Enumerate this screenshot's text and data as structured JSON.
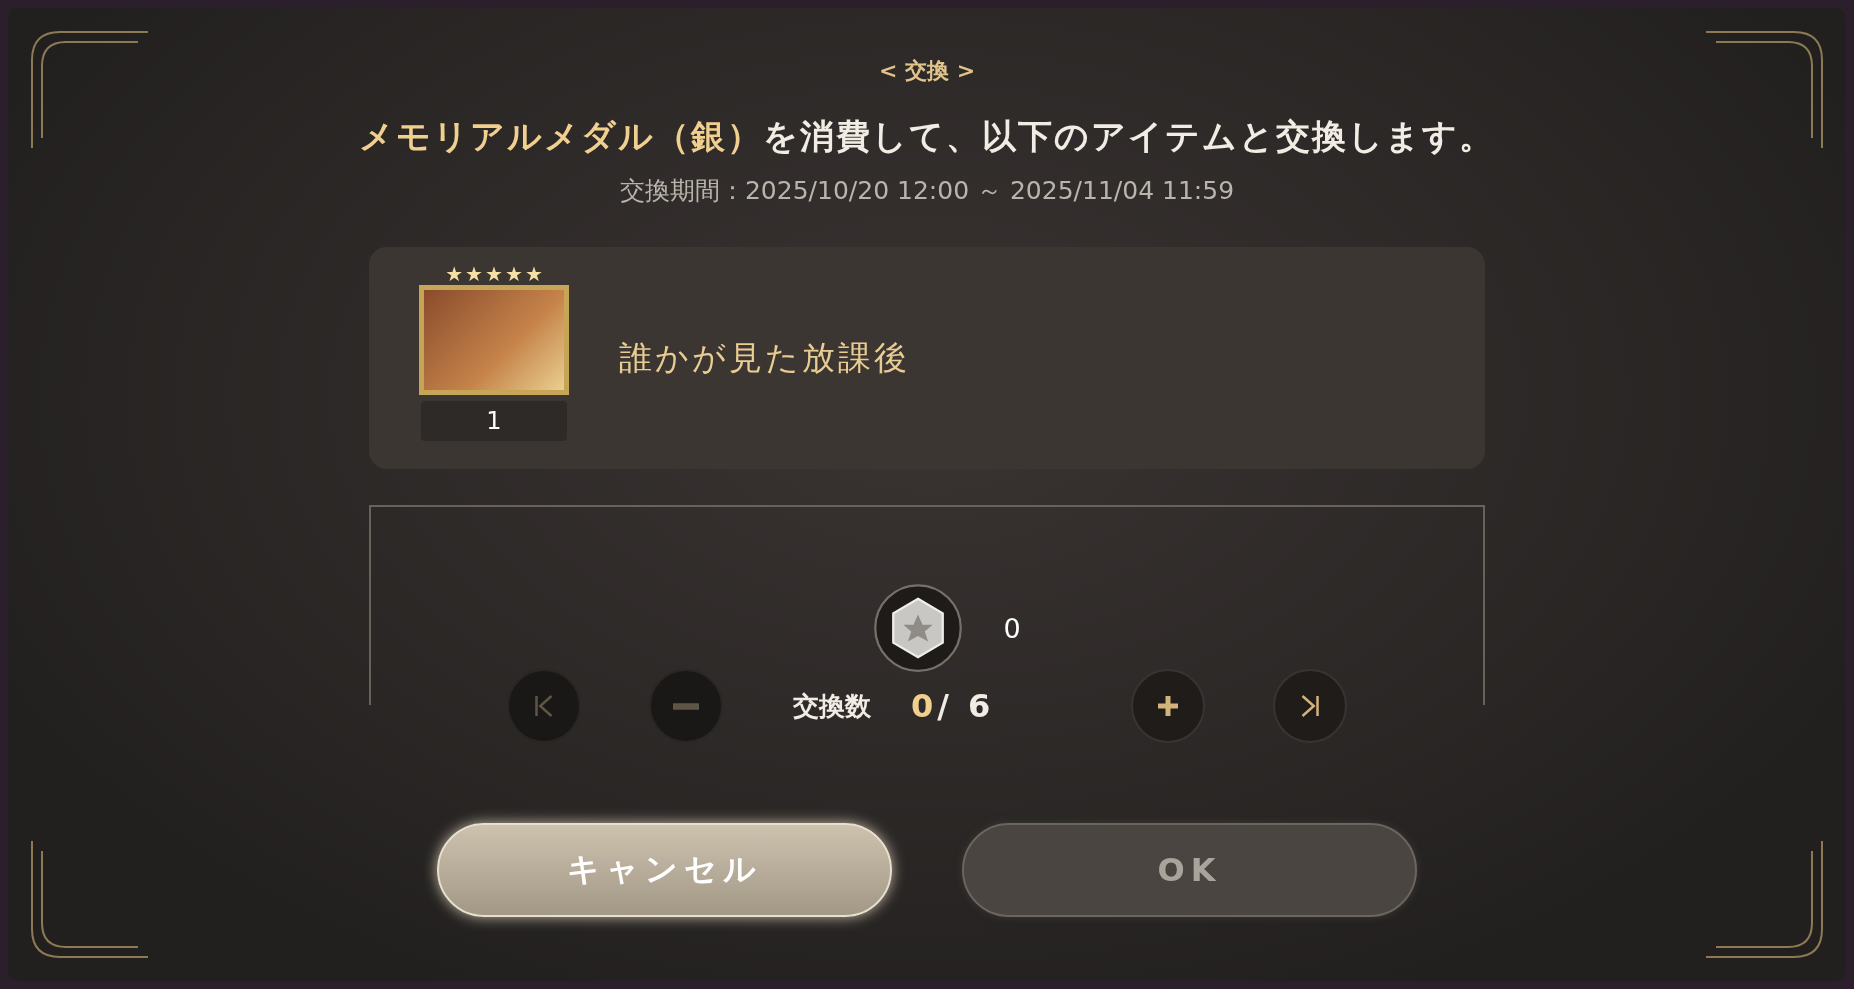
{
  "dialog": {
    "title": "< 交換 >",
    "message": {
      "highlight": "メモリアルメダル（銀）",
      "text": "を消費して、以下のアイテムと交換します。"
    },
    "period": "交換期間：2025/10/20 12:00 ～ 2025/11/04 11:59"
  },
  "item": {
    "name": "誰かが見た放課後",
    "quantity": "1",
    "stars": 5
  },
  "cost": {
    "amount": "0"
  },
  "counter": {
    "label": "交換数",
    "current": "0",
    "rest": "/ 6",
    "steps": [
      {
        "kind": "first",
        "disabled": true
      },
      {
        "kind": "minus",
        "disabled": true
      },
      {
        "kind": "plus",
        "disabled": false
      },
      {
        "kind": "last",
        "disabled": false
      }
    ]
  },
  "buttons": [
    {
      "label": "キャンセル",
      "disabled": false
    },
    {
      "label": "OK",
      "disabled": true
    }
  ]
}
